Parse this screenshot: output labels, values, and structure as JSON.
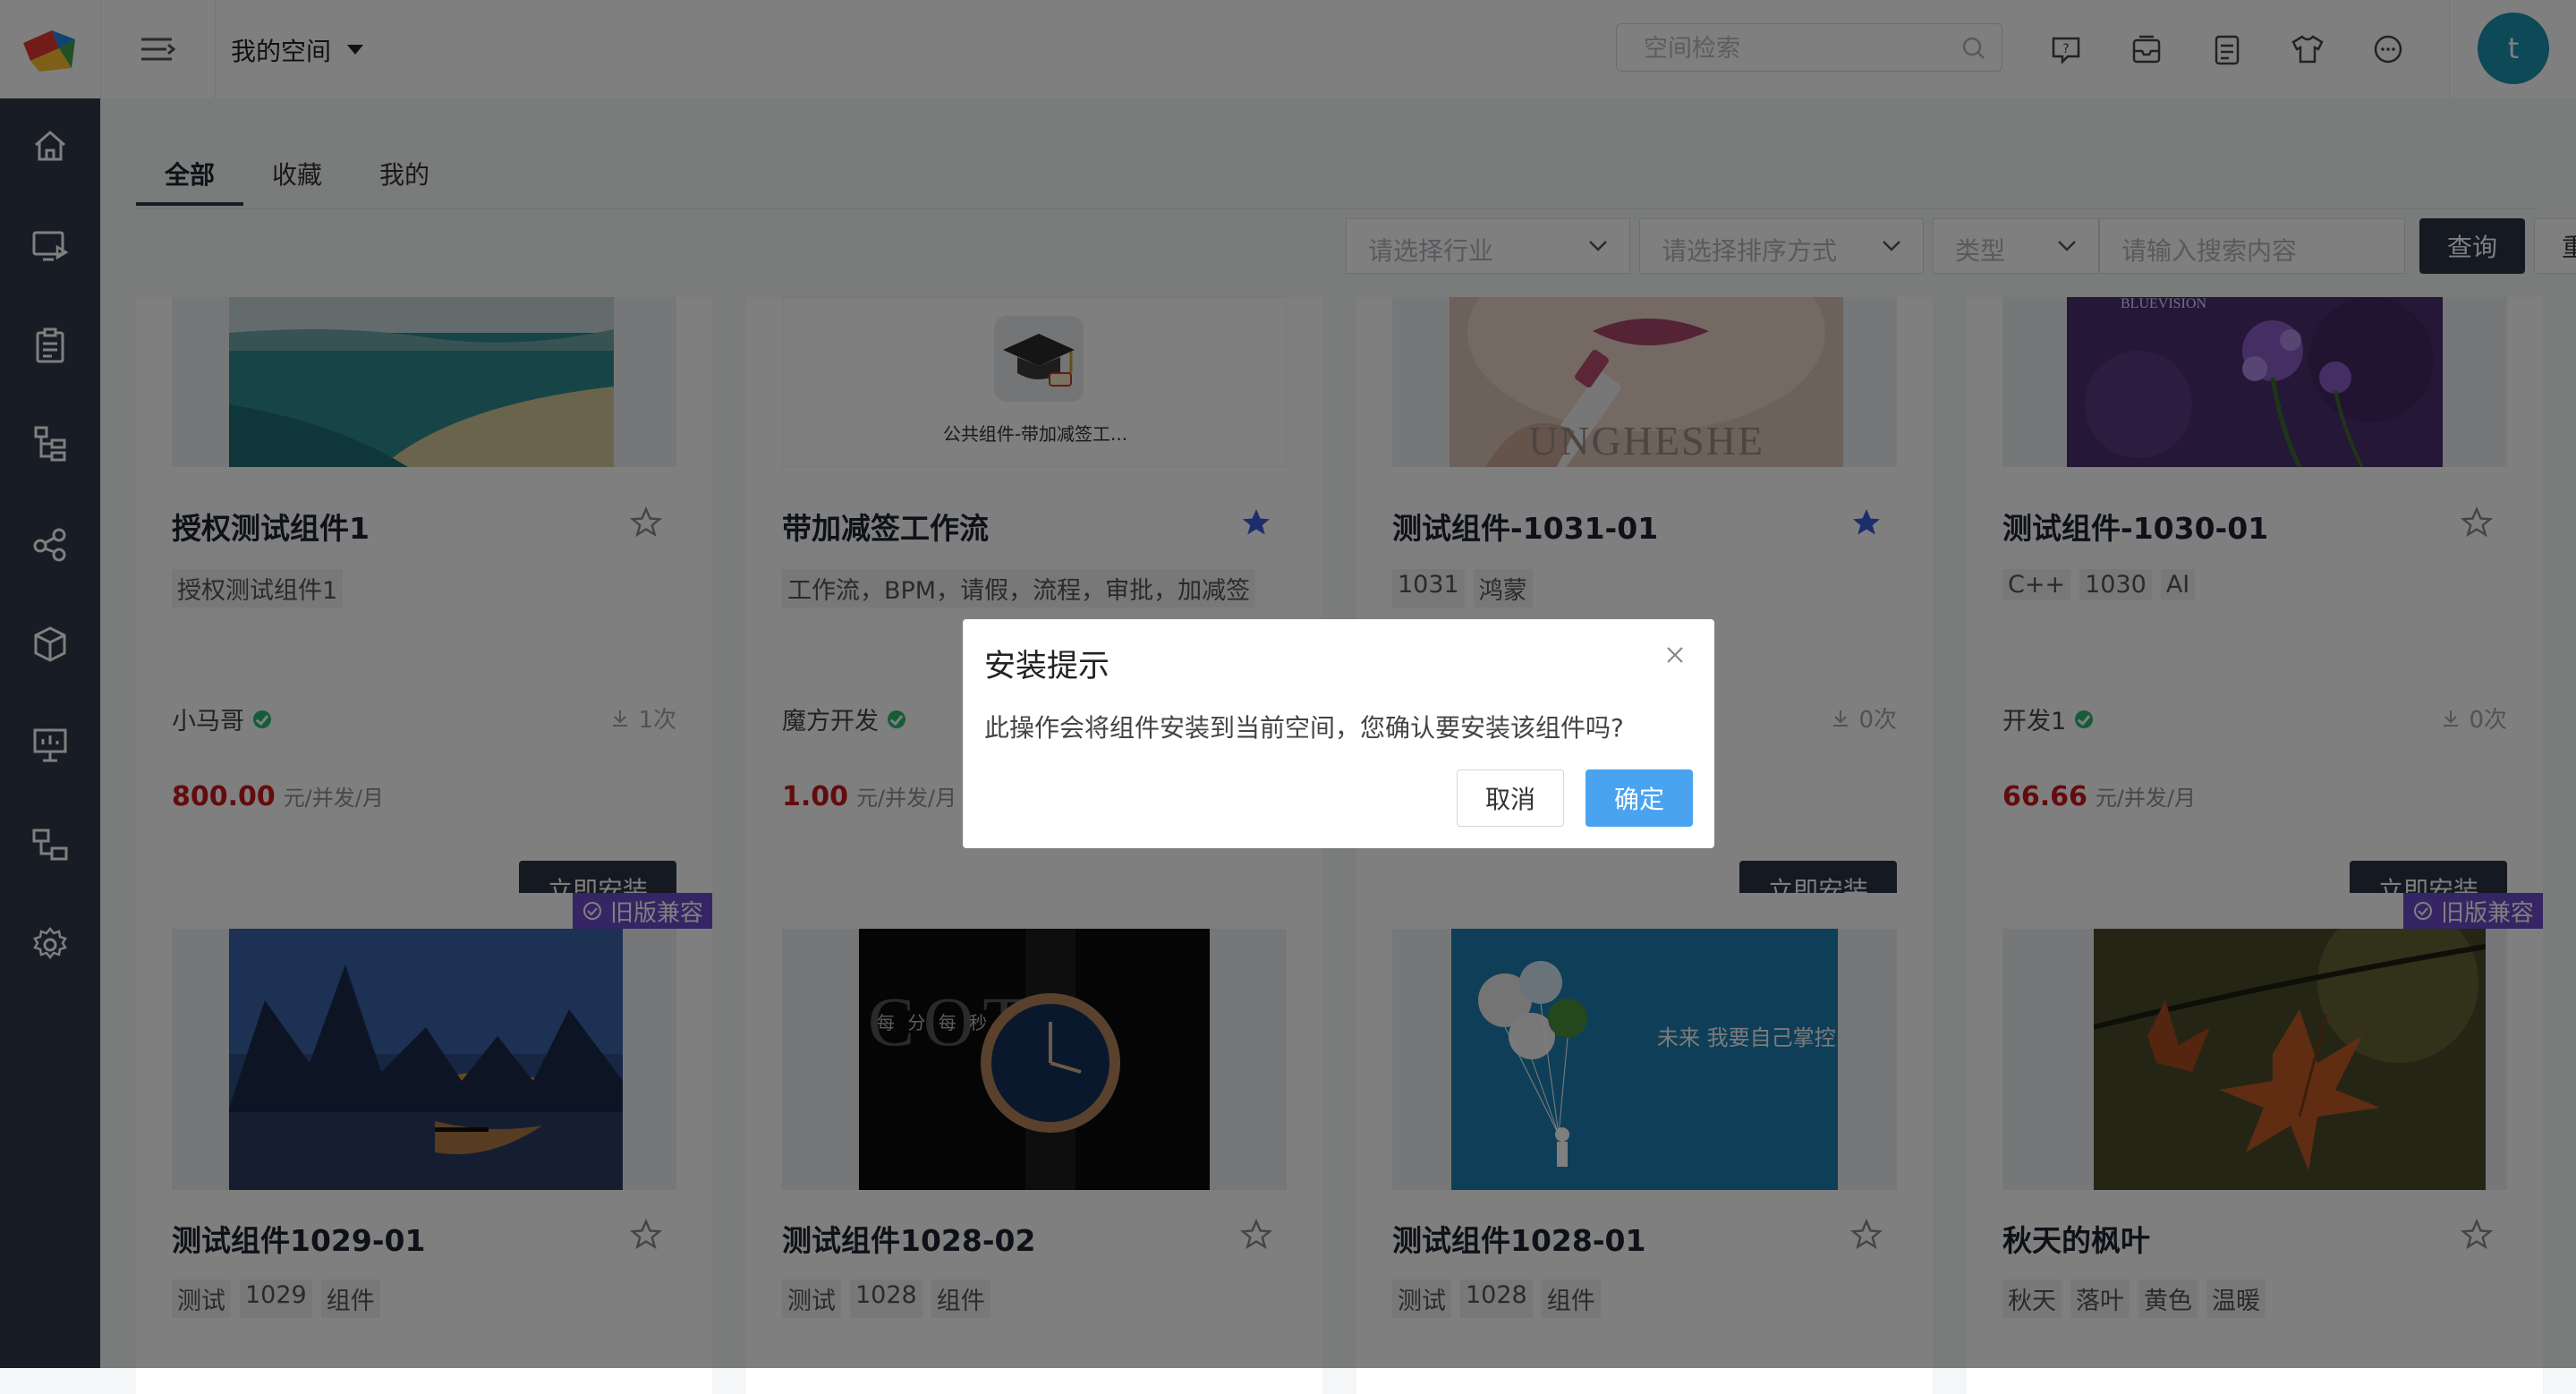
{
  "header": {
    "space_title": "我的空间",
    "search_placeholder": "空间检索",
    "avatar_letter": "t",
    "icons": [
      "help-icon",
      "inbox-icon",
      "notes-icon",
      "theme-shirt-icon",
      "chat-icon"
    ]
  },
  "sidebar": {
    "items": [
      "home-icon",
      "monitor-play-icon",
      "clipboard-icon",
      "tree-icon",
      "share-icon",
      "cube-icon",
      "presentation-icon",
      "flow-icon",
      "settings-icon"
    ]
  },
  "tabs": [
    "全部",
    "收藏",
    "我的"
  ],
  "filters": {
    "industry_placeholder": "请选择行业",
    "sort_placeholder": "请选择排序方式",
    "type_placeholder": "类型",
    "keyword_placeholder": "请输入搜索内容",
    "query_label": "查询",
    "reset_label": "重置"
  },
  "install_label": "立即安装",
  "legacy_badge": "旧版兼容",
  "cards_row1": [
    {
      "title": "授权测试组件1",
      "tags": [
        "授权测试组件1"
      ],
      "author": "小马哥",
      "downloads": "1次",
      "price": "800.00",
      "unit": "元/并发/月",
      "starred": false
    },
    {
      "title": "带加减签工作流",
      "tags": [
        "工作流，BPM，请假，流程，审批，加减签"
      ],
      "author": "魔方开发",
      "downloads": "",
      "price": "1.00",
      "unit": "元/并发/月",
      "starred": true,
      "thumb_caption": "公共组件-带加减签工..."
    },
    {
      "title": "测试组件-1031-01",
      "tags": [
        "1031",
        "鸿蒙"
      ],
      "author": "",
      "downloads": "0次",
      "price": "",
      "unit": "",
      "starred": true,
      "thumb_text": "UNGHESHE"
    },
    {
      "title": "测试组件-1030-01",
      "tags": [
        "C++",
        "1030",
        "AI"
      ],
      "author": "开发1",
      "downloads": "0次",
      "price": "66.66",
      "unit": "元/并发/月",
      "starred": false,
      "thumb_text": "BLUEVISION"
    }
  ],
  "cards_row2": [
    {
      "title": "测试组件1029-01",
      "tags": [
        "测试",
        "1029",
        "组件"
      ],
      "legacy": true,
      "starred": false
    },
    {
      "title": "测试组件1028-02",
      "tags": [
        "测试",
        "1028",
        "组件"
      ],
      "legacy": false,
      "starred": false,
      "thumb_text": "COT",
      "thumb_sub": "每 分 每 秒"
    },
    {
      "title": "测试组件1028-01",
      "tags": [
        "测试",
        "1028",
        "组件"
      ],
      "legacy": false,
      "starred": false,
      "thumb_text": "未来 我要自己掌控"
    },
    {
      "title": "秋天的枫叶",
      "tags": [
        "秋天",
        "落叶",
        "黄色",
        "温暖"
      ],
      "legacy": true,
      "starred": false
    }
  ],
  "dialog": {
    "title": "安装提示",
    "message": "此操作会将组件安装到当前空间，您确认要安装该组件吗?",
    "cancel_label": "取消",
    "confirm_label": "确定"
  },
  "colors": {
    "sidebar_bg": "#303849",
    "primary_dark": "#2b3344",
    "confirm_blue": "#4aa3ef",
    "price_red": "#c8161d",
    "legacy_purple": "#6b4ac9",
    "avatar_teal": "#1a93ad",
    "verified_green": "#2eb872",
    "star_blue": "#3b5bdb"
  }
}
